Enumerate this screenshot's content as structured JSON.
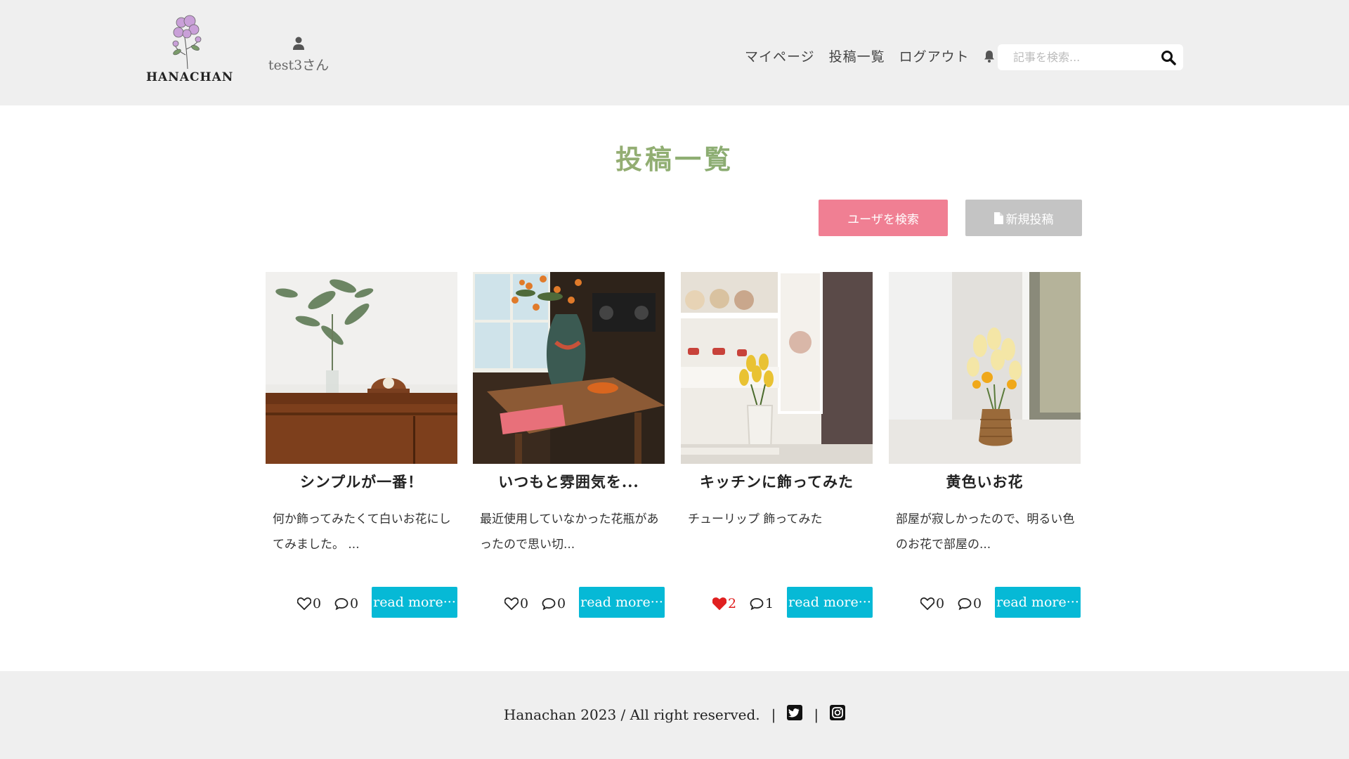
{
  "header": {
    "logo_text": "HANACHAN",
    "user_name": "test3さん",
    "nav": {
      "mypage": "マイページ",
      "posts": "投稿一覧",
      "logout": "ログアウト"
    },
    "search_placeholder": "記事を検索..."
  },
  "page": {
    "title": "投稿一覧",
    "user_search_button": "ユーザを検索",
    "new_post_button": "新規投稿"
  },
  "cards": [
    {
      "title": "シンプルが一番！",
      "body": "何か飾ってみたくて白いお花にしてみました。 ...",
      "likes": "0",
      "comments": "0",
      "liked": false,
      "read_more": "read more···"
    },
    {
      "title": "いつもと雰囲気を...",
      "body": "最近使用していなかった花瓶があったので思い切...",
      "likes": "0",
      "comments": "0",
      "liked": false,
      "read_more": "read more···"
    },
    {
      "title": "キッチンに飾ってみた",
      "body": "チューリップ 飾ってみた",
      "likes": "2",
      "comments": "1",
      "liked": true,
      "read_more": "read more···"
    },
    {
      "title": "黄色いお花",
      "body": "部屋が寂しかったので、明るい色のお花で部屋の...",
      "likes": "0",
      "comments": "0",
      "liked": false,
      "read_more": "read more···"
    }
  ],
  "footer": {
    "copyright": "Hanachan 2023 / All right reserved.",
    "separator": "|"
  },
  "colors": {
    "accent_pink": "#f07f93",
    "read_more_cyan": "#06b9d6",
    "liked_heart": "#e02020"
  },
  "icons": [
    "user-icon",
    "bell-icon",
    "search-icon",
    "file-icon",
    "heart-icon",
    "comment-icon",
    "twitter-icon",
    "instagram-icon"
  ]
}
